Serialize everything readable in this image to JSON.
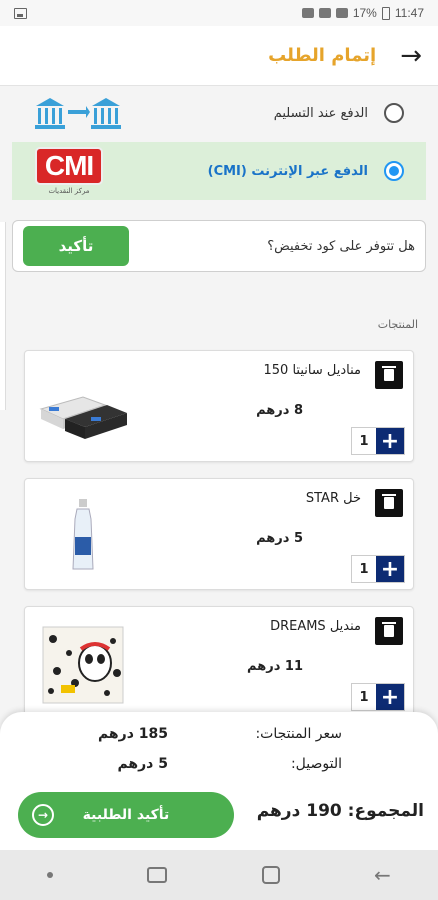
{
  "status_bar": {
    "battery": "17%",
    "time": "11:47"
  },
  "header": {
    "title": "إتمام الطلب",
    "back_icon": "arrow-right-icon"
  },
  "payment": {
    "options": [
      {
        "label": "الدفع عند التسليم",
        "selected": false,
        "icon": "bank-transfer-icon"
      },
      {
        "label": "الدفع عبر الإنترنت (CMI)",
        "selected": true,
        "logo_text": "CMI",
        "logo_sub": "مركز النقديات"
      }
    ]
  },
  "coupon": {
    "label": "هل تتوفر على كود تخفيض؟",
    "button": "تأكيد"
  },
  "products_title": "المنتجات",
  "products": [
    {
      "name": "مناديل سانيتا 150",
      "price": "8 درهم",
      "qty": "1"
    },
    {
      "name": "خل STAR",
      "price": "5 درهم",
      "qty": "1"
    },
    {
      "name": "منديل DREAMS",
      "price": "11 درهم",
      "qty": "1"
    }
  ],
  "summary": {
    "products_price_label": "سعر المنتجات:",
    "products_price_value": "185 درهم",
    "delivery_label": "التوصيل:",
    "delivery_value": "5 درهم",
    "total": "المجموع: 190 درهم",
    "checkout_button": "تأكيد الطلبية"
  },
  "colors": {
    "accent": "#e6a42b",
    "green": "#4caf50",
    "navy": "#0d2b73",
    "selected_bg": "#dcefd9"
  }
}
